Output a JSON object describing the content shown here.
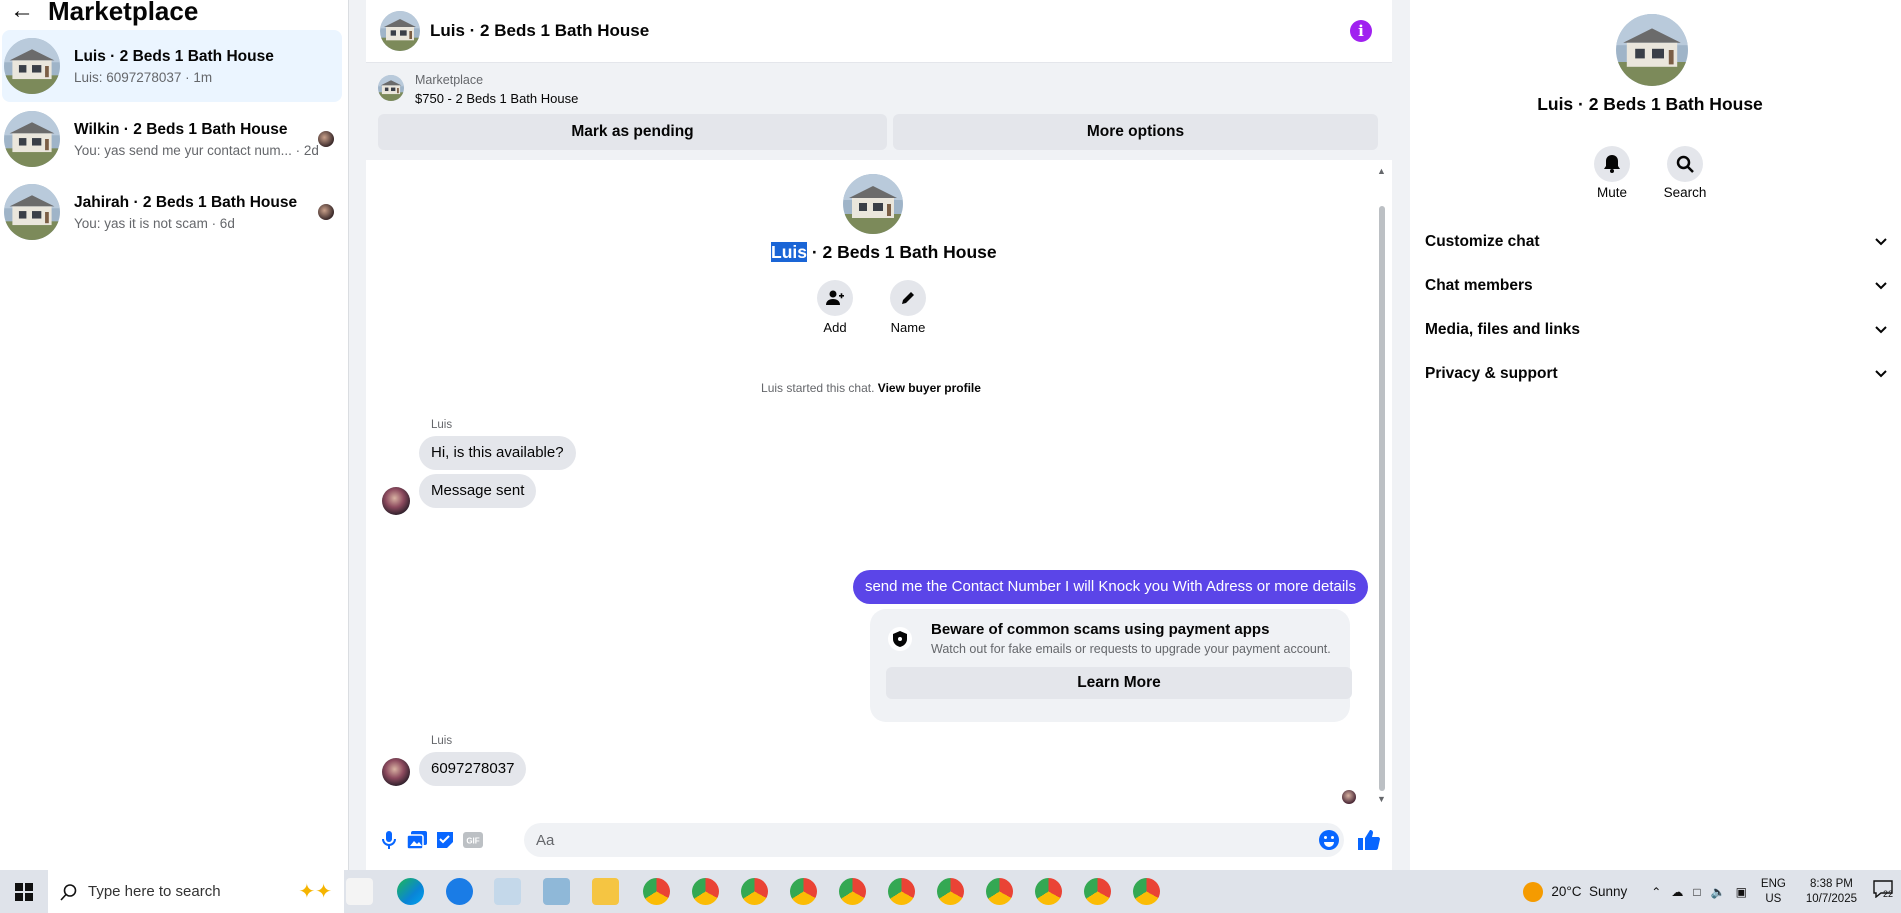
{
  "sidebar": {
    "title": "Marketplace",
    "conversations": [
      {
        "title": "Luis · 2 Beds 1 Bath House",
        "preview": "Luis: 6097278037 · 1m"
      },
      {
        "title": "Wilkin · 2 Beds 1 Bath House",
        "preview": "You: yas send me yur contact num... · 2d"
      },
      {
        "title": "Jahirah · 2 Beds 1 Bath House",
        "preview": "You: yas it is not scam · 6d"
      }
    ]
  },
  "chat": {
    "title": "Luis · 2 Beds 1 Bath House",
    "listing": {
      "label": "Marketplace",
      "price_line": "$750 - 2 Beds 1 Bath House"
    },
    "buttons": {
      "mark_pending": "Mark as pending",
      "more_options": "More options"
    },
    "header": {
      "name_highlight": "Luis",
      "name_rest": " · 2 Beds 1 Bath House",
      "add_label": "Add",
      "name_label": "Name"
    },
    "started": {
      "text": "Luis started this chat. ",
      "link": "View buyer profile"
    },
    "messages": [
      {
        "sender": "Luis",
        "text": "Hi, is this available?"
      },
      {
        "text": "Message sent"
      },
      {
        "text": "send me the Contact Number I will Knock you With Adress or more details"
      },
      {
        "sender": "Luis",
        "text": "6097278037"
      }
    ],
    "scam_notice": {
      "title": "Beware of common scams using payment apps",
      "text": "Watch out for fake emails or requests to upgrade your payment account.",
      "button": "Learn More"
    },
    "composer": {
      "placeholder": "Aa"
    }
  },
  "right_panel": {
    "title": "Luis · 2 Beds 1 Bath House",
    "actions": [
      {
        "label": "Mute",
        "icon": "bell-icon"
      },
      {
        "label": "Search",
        "icon": "search-icon"
      }
    ],
    "sections": [
      "Customize chat",
      "Chat members",
      "Media, files and links",
      "Privacy & support"
    ]
  },
  "taskbar": {
    "search_placeholder": "Type here to search",
    "weather": "20°C  Sunny",
    "lang_top": "ENG",
    "lang_bottom": "US",
    "time": "8:38 PM",
    "date": "10/7/2025",
    "notif_count": "22"
  },
  "colors": {
    "accent": "#5b45e8",
    "info": "#a020f0",
    "link_blue": "#0866ff",
    "highlight": "#1a65d6"
  }
}
